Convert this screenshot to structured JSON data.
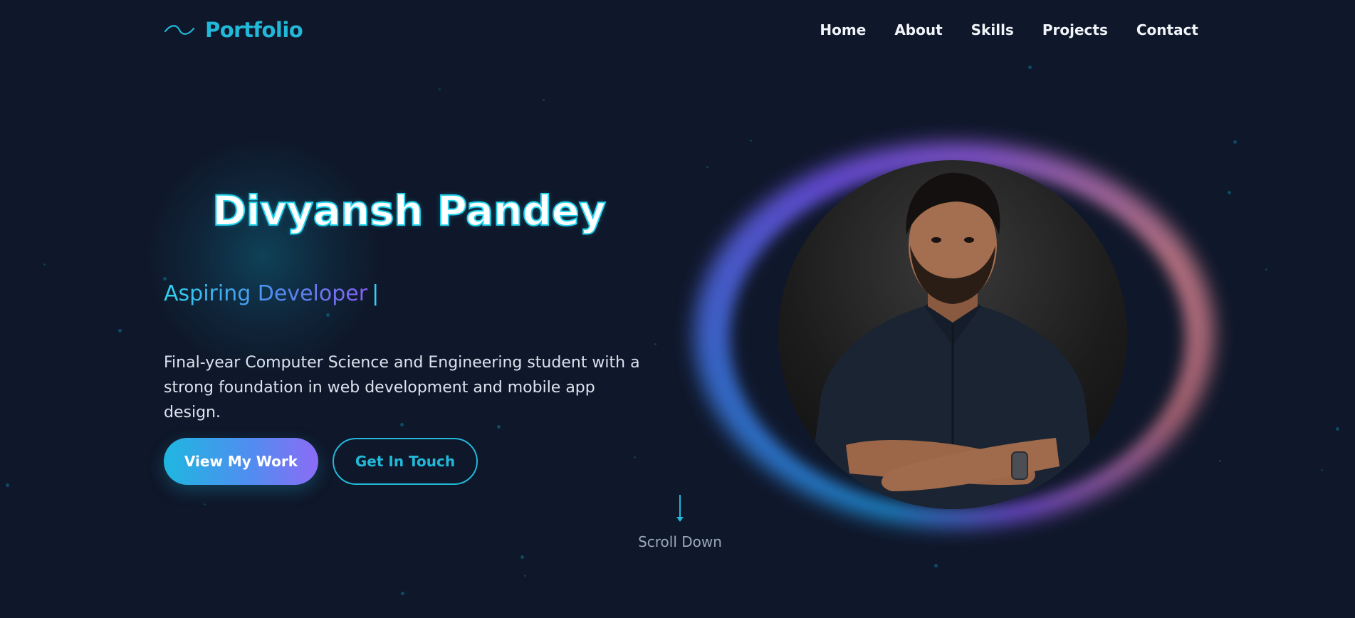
{
  "brand": {
    "logo_icon": "wave-icon",
    "name": "Portfolio"
  },
  "nav": {
    "items": [
      {
        "label": "Home"
      },
      {
        "label": "About"
      },
      {
        "label": "Skills"
      },
      {
        "label": "Projects"
      },
      {
        "label": "Contact"
      }
    ]
  },
  "hero": {
    "name": "Divyansh Pandey",
    "role": "Aspiring Developer",
    "role_caret": "|",
    "description": "Final-year Computer Science and Engineering student with a strong foundation in web development and mobile app design.",
    "primary_button": "View My Work",
    "secondary_button": "Get In Touch"
  },
  "scroll": {
    "icon": "arrow-down-icon",
    "label": "Scroll Down"
  },
  "profile": {
    "image": "profile-photo"
  },
  "colors": {
    "background": "#0f172a",
    "accent": "#22b8d8",
    "gradient_start": "#1fb7e0",
    "gradient_end": "#8b6cf6"
  }
}
